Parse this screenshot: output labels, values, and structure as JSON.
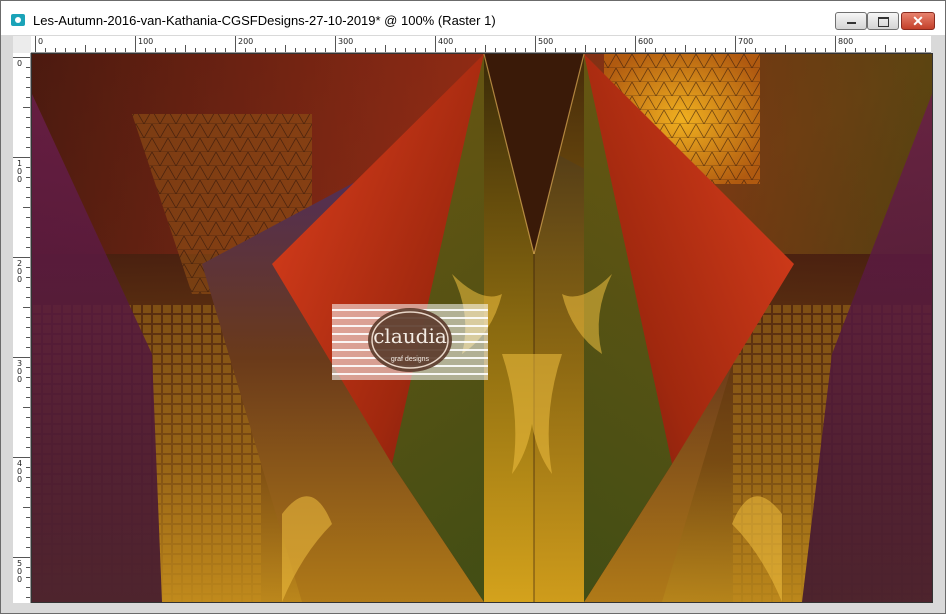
{
  "window": {
    "title": "Les-Autumn-2016-van-Kathania-CGSFDesigns-27-10-2019* @ 100% (Raster 1)",
    "icon": "image-document-icon",
    "buttons": {
      "minimize_icon": "minimize-icon",
      "maximize_icon": "maximize-icon",
      "close_icon": "close-icon",
      "close_glyph": "✕"
    }
  },
  "rulers": {
    "horizontal_labels": [
      "0",
      "100",
      "200",
      "300",
      "400",
      "500",
      "600",
      "700",
      "800"
    ],
    "vertical_labels": [
      "0",
      "100",
      "200",
      "300",
      "400",
      "500"
    ]
  },
  "canvas": {
    "watermark_text": "claudia",
    "watermark_subtext": "graf designs",
    "colors": {
      "red": "#c8321a",
      "orange": "#d9651a",
      "gold": "#d4a21c",
      "olive": "#5e5a12",
      "green": "#3f5416",
      "purple": "#6a1e4a",
      "violet": "#4a2a6a",
      "dark": "#2a120a"
    }
  }
}
